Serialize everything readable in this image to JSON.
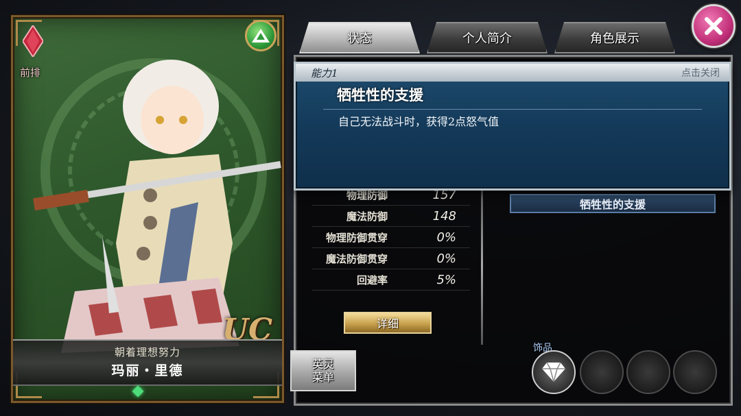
{
  "card": {
    "position": "前排",
    "rarity": "UC",
    "epithet": "朝着理想努力",
    "name": "玛丽・里德",
    "element_icon": "mountain-icon"
  },
  "tabs": [
    {
      "label": "状态",
      "active": true
    },
    {
      "label": "个人简介",
      "active": false
    },
    {
      "label": "角色展示",
      "active": false
    }
  ],
  "stats": [
    {
      "label": "物理防御",
      "value": "157"
    },
    {
      "label": "魔法防御",
      "value": "148"
    },
    {
      "label": "物理防御贯穿",
      "value": "0%"
    },
    {
      "label": "魔法防御贯穿",
      "value": "0%"
    },
    {
      "label": "回避率",
      "value": "5%"
    }
  ],
  "detail_button": "详细",
  "skill_tag": "牺牲性的支援",
  "hero_menu_button": "英灵\n菜单",
  "accessory_label": "饰品",
  "popup": {
    "ability_label": "能力1",
    "close_hint": "点击关闭",
    "title": "牺牲性的支援",
    "description": "自己无法战斗时，获得2点怒气值"
  },
  "colors": {
    "card_green": "#2f5a2d",
    "popup_blue": "#143a5a",
    "close_pink": "#c2307a",
    "detail_gold": "#c9a24e"
  }
}
